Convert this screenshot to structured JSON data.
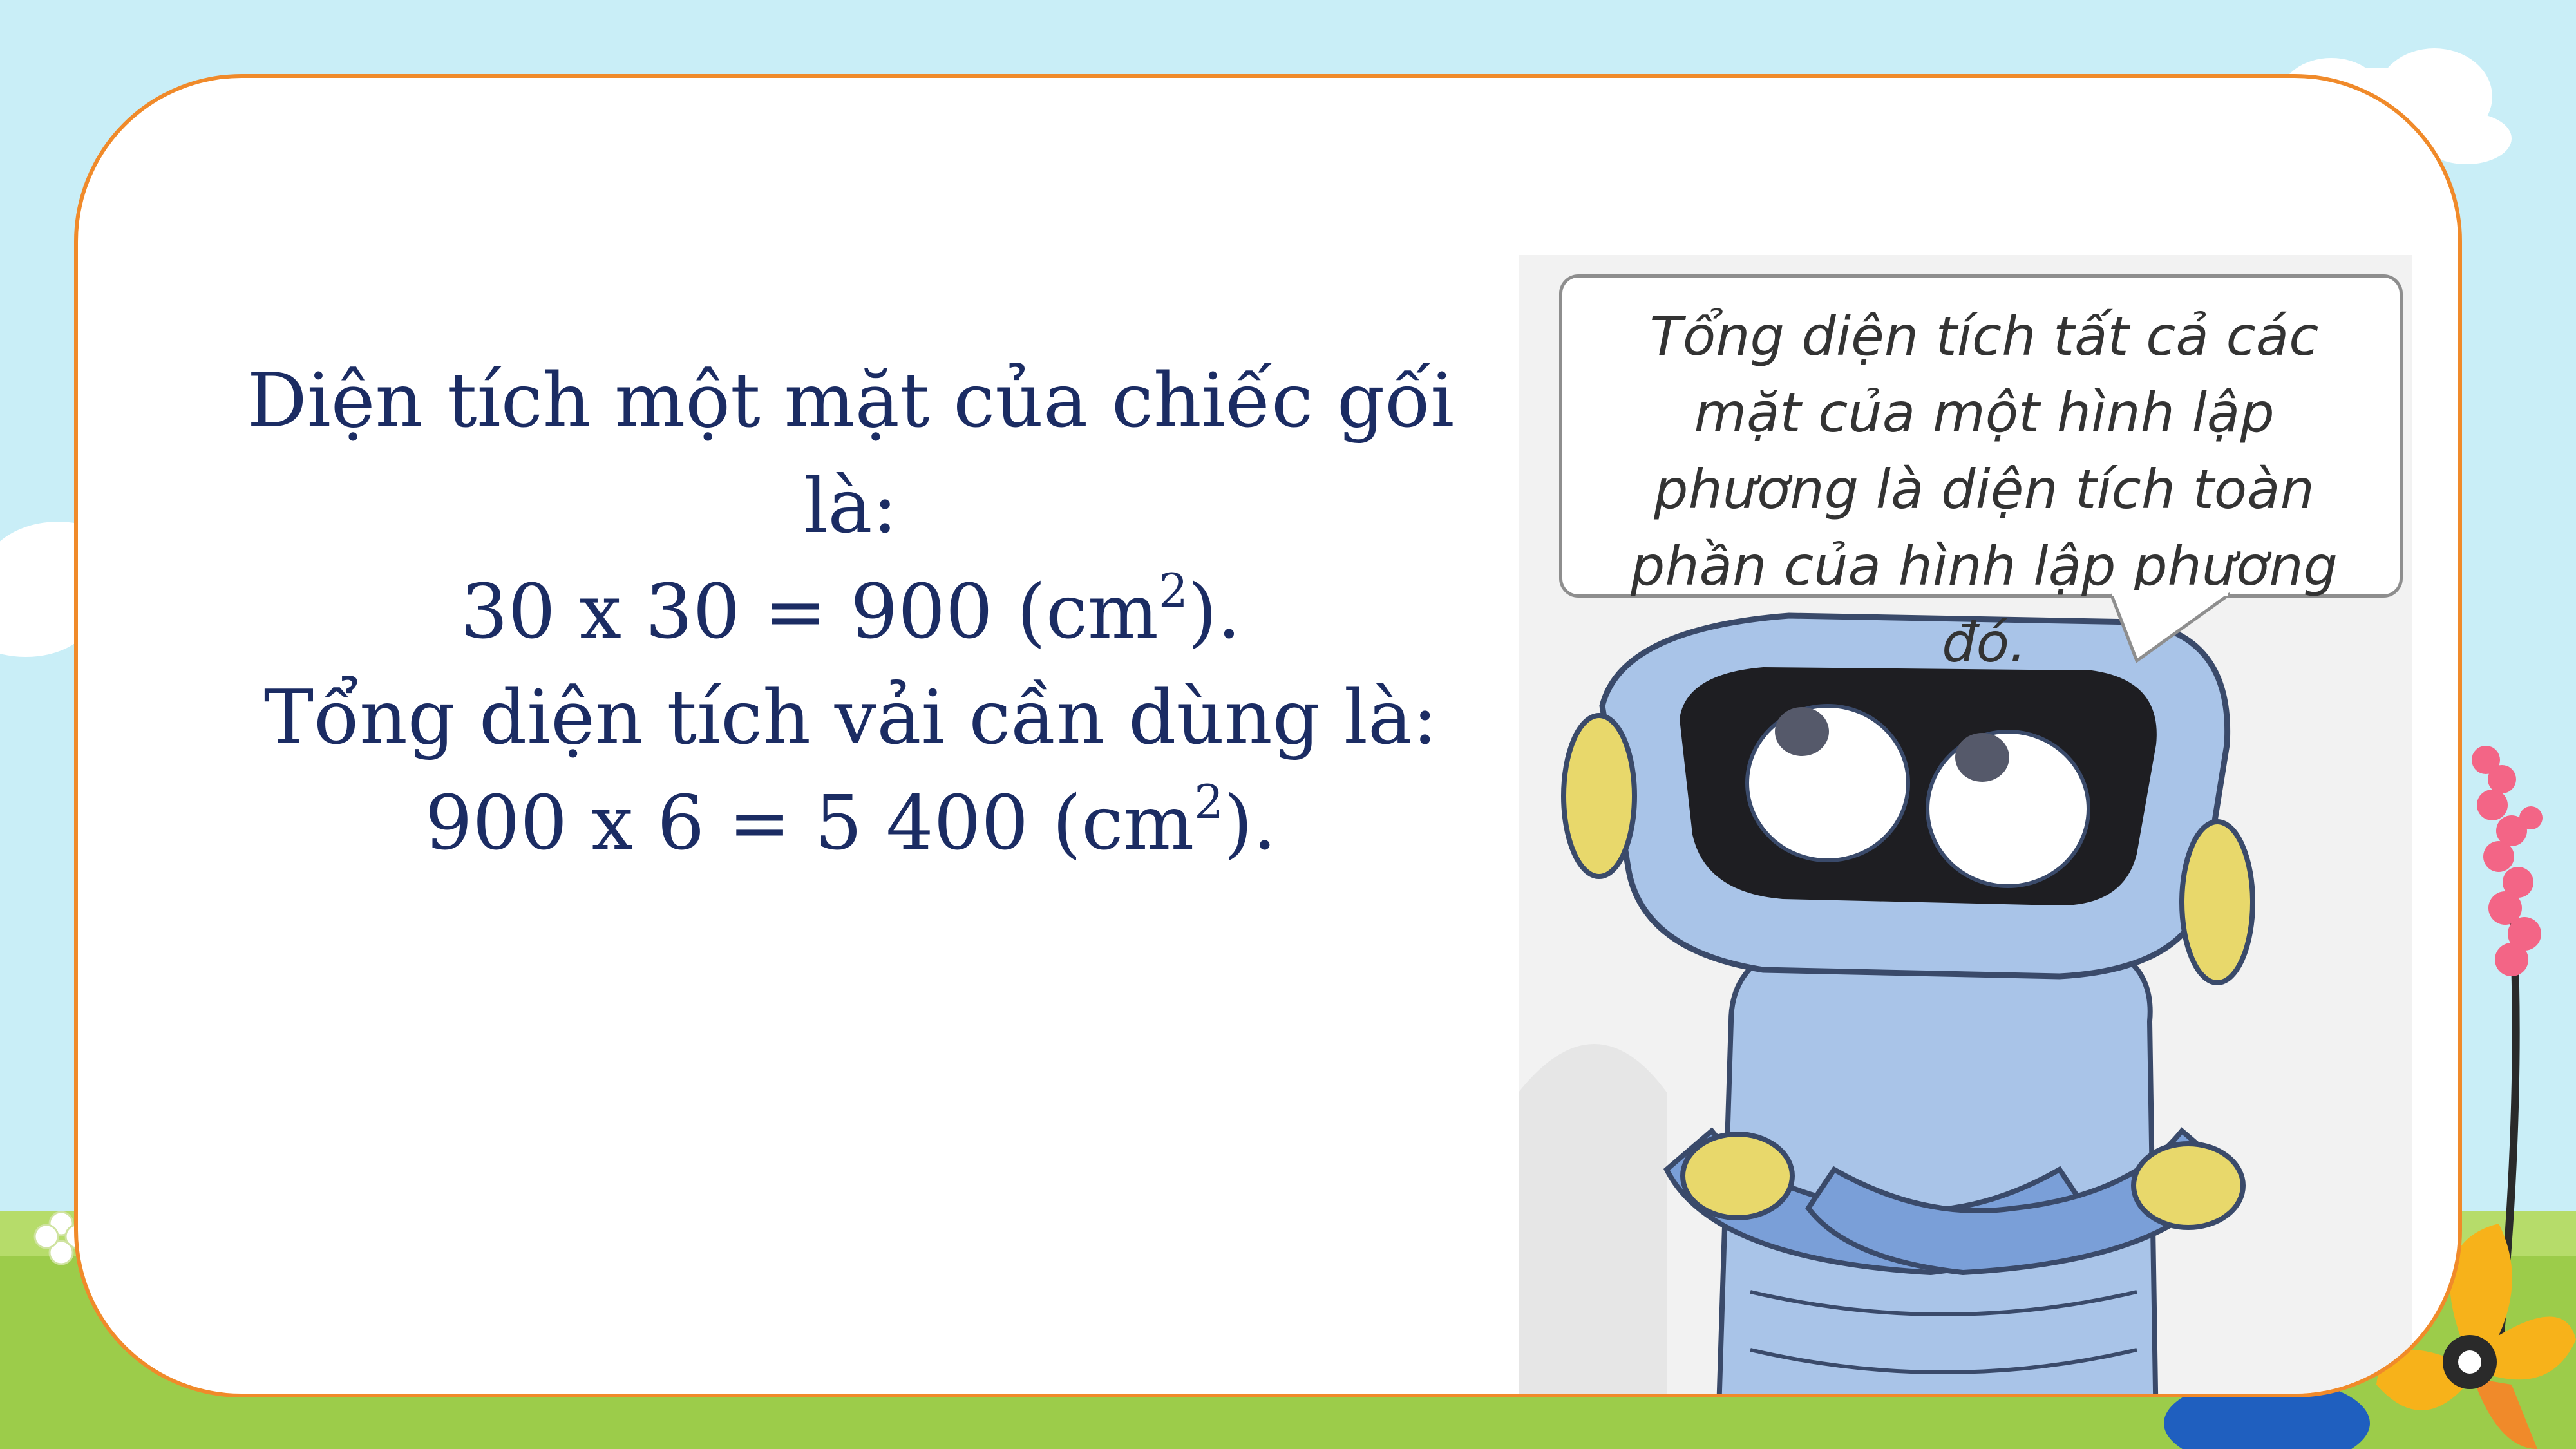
{
  "slide": {
    "solution_lines": [
      {
        "text": "Diện tích một mặt của chiếc gối là:",
        "sup": "",
        "after": ""
      },
      {
        "text": "30 x 30 = 900 (cm",
        "sup": "2",
        "after": ")."
      },
      {
        "text": "Tổng diện tích vải cần dùng là:",
        "sup": "",
        "after": ""
      },
      {
        "text": "900 x 6 = 5 400 (cm",
        "sup": "2",
        "after": ")."
      }
    ],
    "speech_bubble": {
      "text": "Tổng diện tích tất cả các mặt của một hình lập phương là diện tích toàn phần của hình lập phương đó."
    }
  },
  "colors": {
    "card_border": "#f08a2a",
    "text": "#1b2c63",
    "sky": "#c9eef7",
    "grass": "#9ccc4a",
    "robot_body": "#a9c4e8",
    "robot_ear": "#e8d86b"
  },
  "icons": [
    "robot-mascot",
    "cloud",
    "flower",
    "grass"
  ]
}
